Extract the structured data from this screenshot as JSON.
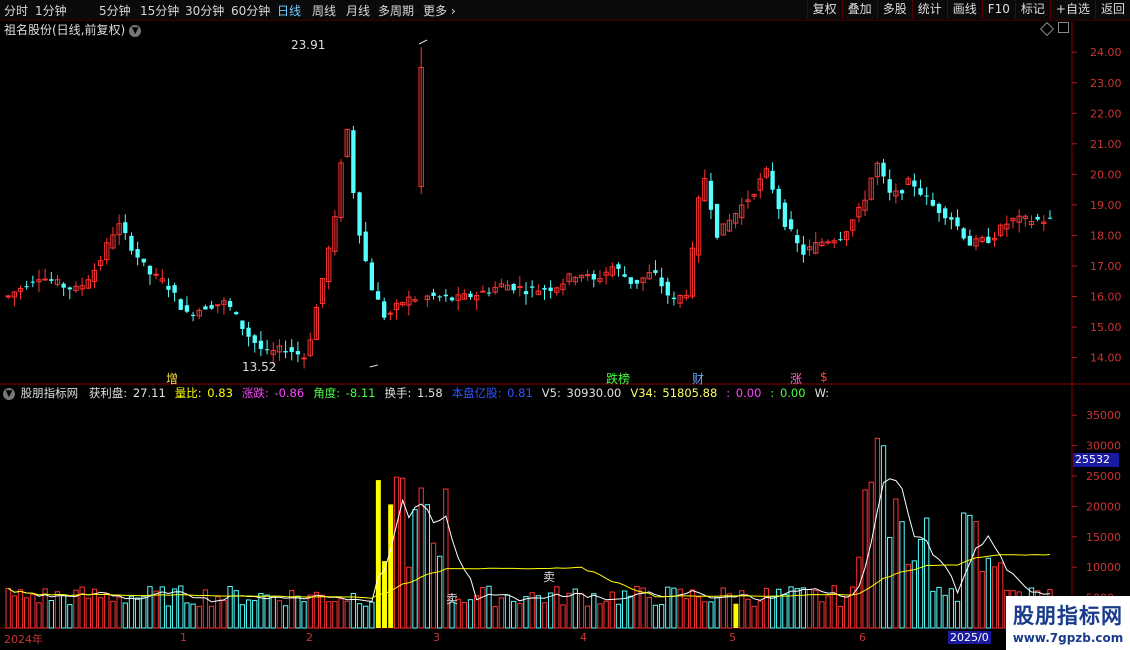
{
  "toolbar": {
    "periods": [
      "分时",
      "1分钟",
      "5分钟",
      "15分钟",
      "30分钟",
      "60分钟",
      "日线",
      "周线",
      "月线",
      "多周期",
      "更多"
    ],
    "active": "日线",
    "tools": [
      "复权",
      "叠加",
      "多股",
      "统计",
      "画线",
      "F10",
      "标记",
      "+自选",
      "返回"
    ]
  },
  "header": {
    "title": "祖名股份(日线,前复权)"
  },
  "price_axis": {
    "ticks": [
      "24.00",
      "23.00",
      "22.00",
      "21.00",
      "20.00",
      "19.00",
      "18.00",
      "17.00",
      "16.00",
      "15.00",
      "14.00"
    ],
    "high_label": "23.91",
    "low_label": "13.52"
  },
  "events": {
    "e1": "增",
    "e2": "跌榜",
    "e3": "财",
    "e4": "涨",
    "e5": "$"
  },
  "indicator": {
    "name": "股朋指标网",
    "items": [
      {
        "label": "获利盘:",
        "value": "27.11",
        "lc": "#e0e0e0",
        "vc": "#e0e0e0"
      },
      {
        "label": "量比:",
        "value": "0.83",
        "lc": "#ffff00",
        "vc": "#ffff00"
      },
      {
        "label": "涨跌:",
        "value": "-0.86",
        "lc": "#ff44ff",
        "vc": "#ff44ff"
      },
      {
        "label": "角度:",
        "value": "-8.11",
        "lc": "#44ff44",
        "vc": "#44ff44"
      },
      {
        "label": "换手:",
        "value": "1.58",
        "lc": "#e0e0e0",
        "vc": "#e0e0e0"
      },
      {
        "label": "本盘亿股:",
        "value": "0.81",
        "lc": "#3355ff",
        "vc": "#3355ff"
      },
      {
        "label": "V5:",
        "value": "30930.00",
        "lc": "#e0e0e0",
        "vc": "#e0e0e0"
      },
      {
        "label": "V34:",
        "value": "51805.88",
        "lc": "#ffff66",
        "vc": "#ffff66"
      },
      {
        "label": ":",
        "value": "0.00",
        "lc": "#ff44ff",
        "vc": "#ff44ff"
      },
      {
        "label": ":",
        "value": "0.00",
        "lc": "#44ff44",
        "vc": "#44ff44"
      },
      {
        "label": "W:",
        "value": "",
        "lc": "#e0e0e0",
        "vc": "#e0e0e0"
      }
    ]
  },
  "vol_axis": {
    "ticks": [
      "35000",
      "30000",
      "25000",
      "20000",
      "15000",
      "10000",
      "5000"
    ],
    "current": "25532"
  },
  "dates": [
    "2024年",
    "1",
    "2",
    "3",
    "4",
    "5",
    "6",
    "2025/0"
  ],
  "signals": {
    "s1": "卖",
    "s2": "卖"
  },
  "watermark": {
    "big": "股朋指标网",
    "url": "www.7gpzb.com"
  },
  "colors": {
    "up": "#ff3232",
    "down": "#54ffff",
    "ma5": "#ffffff",
    "ma34": "#ffff00"
  },
  "chart_data": {
    "type": "candlestick",
    "price_range": [
      13.2,
      24.4
    ],
    "volume_range": [
      0,
      37500
    ]
  }
}
